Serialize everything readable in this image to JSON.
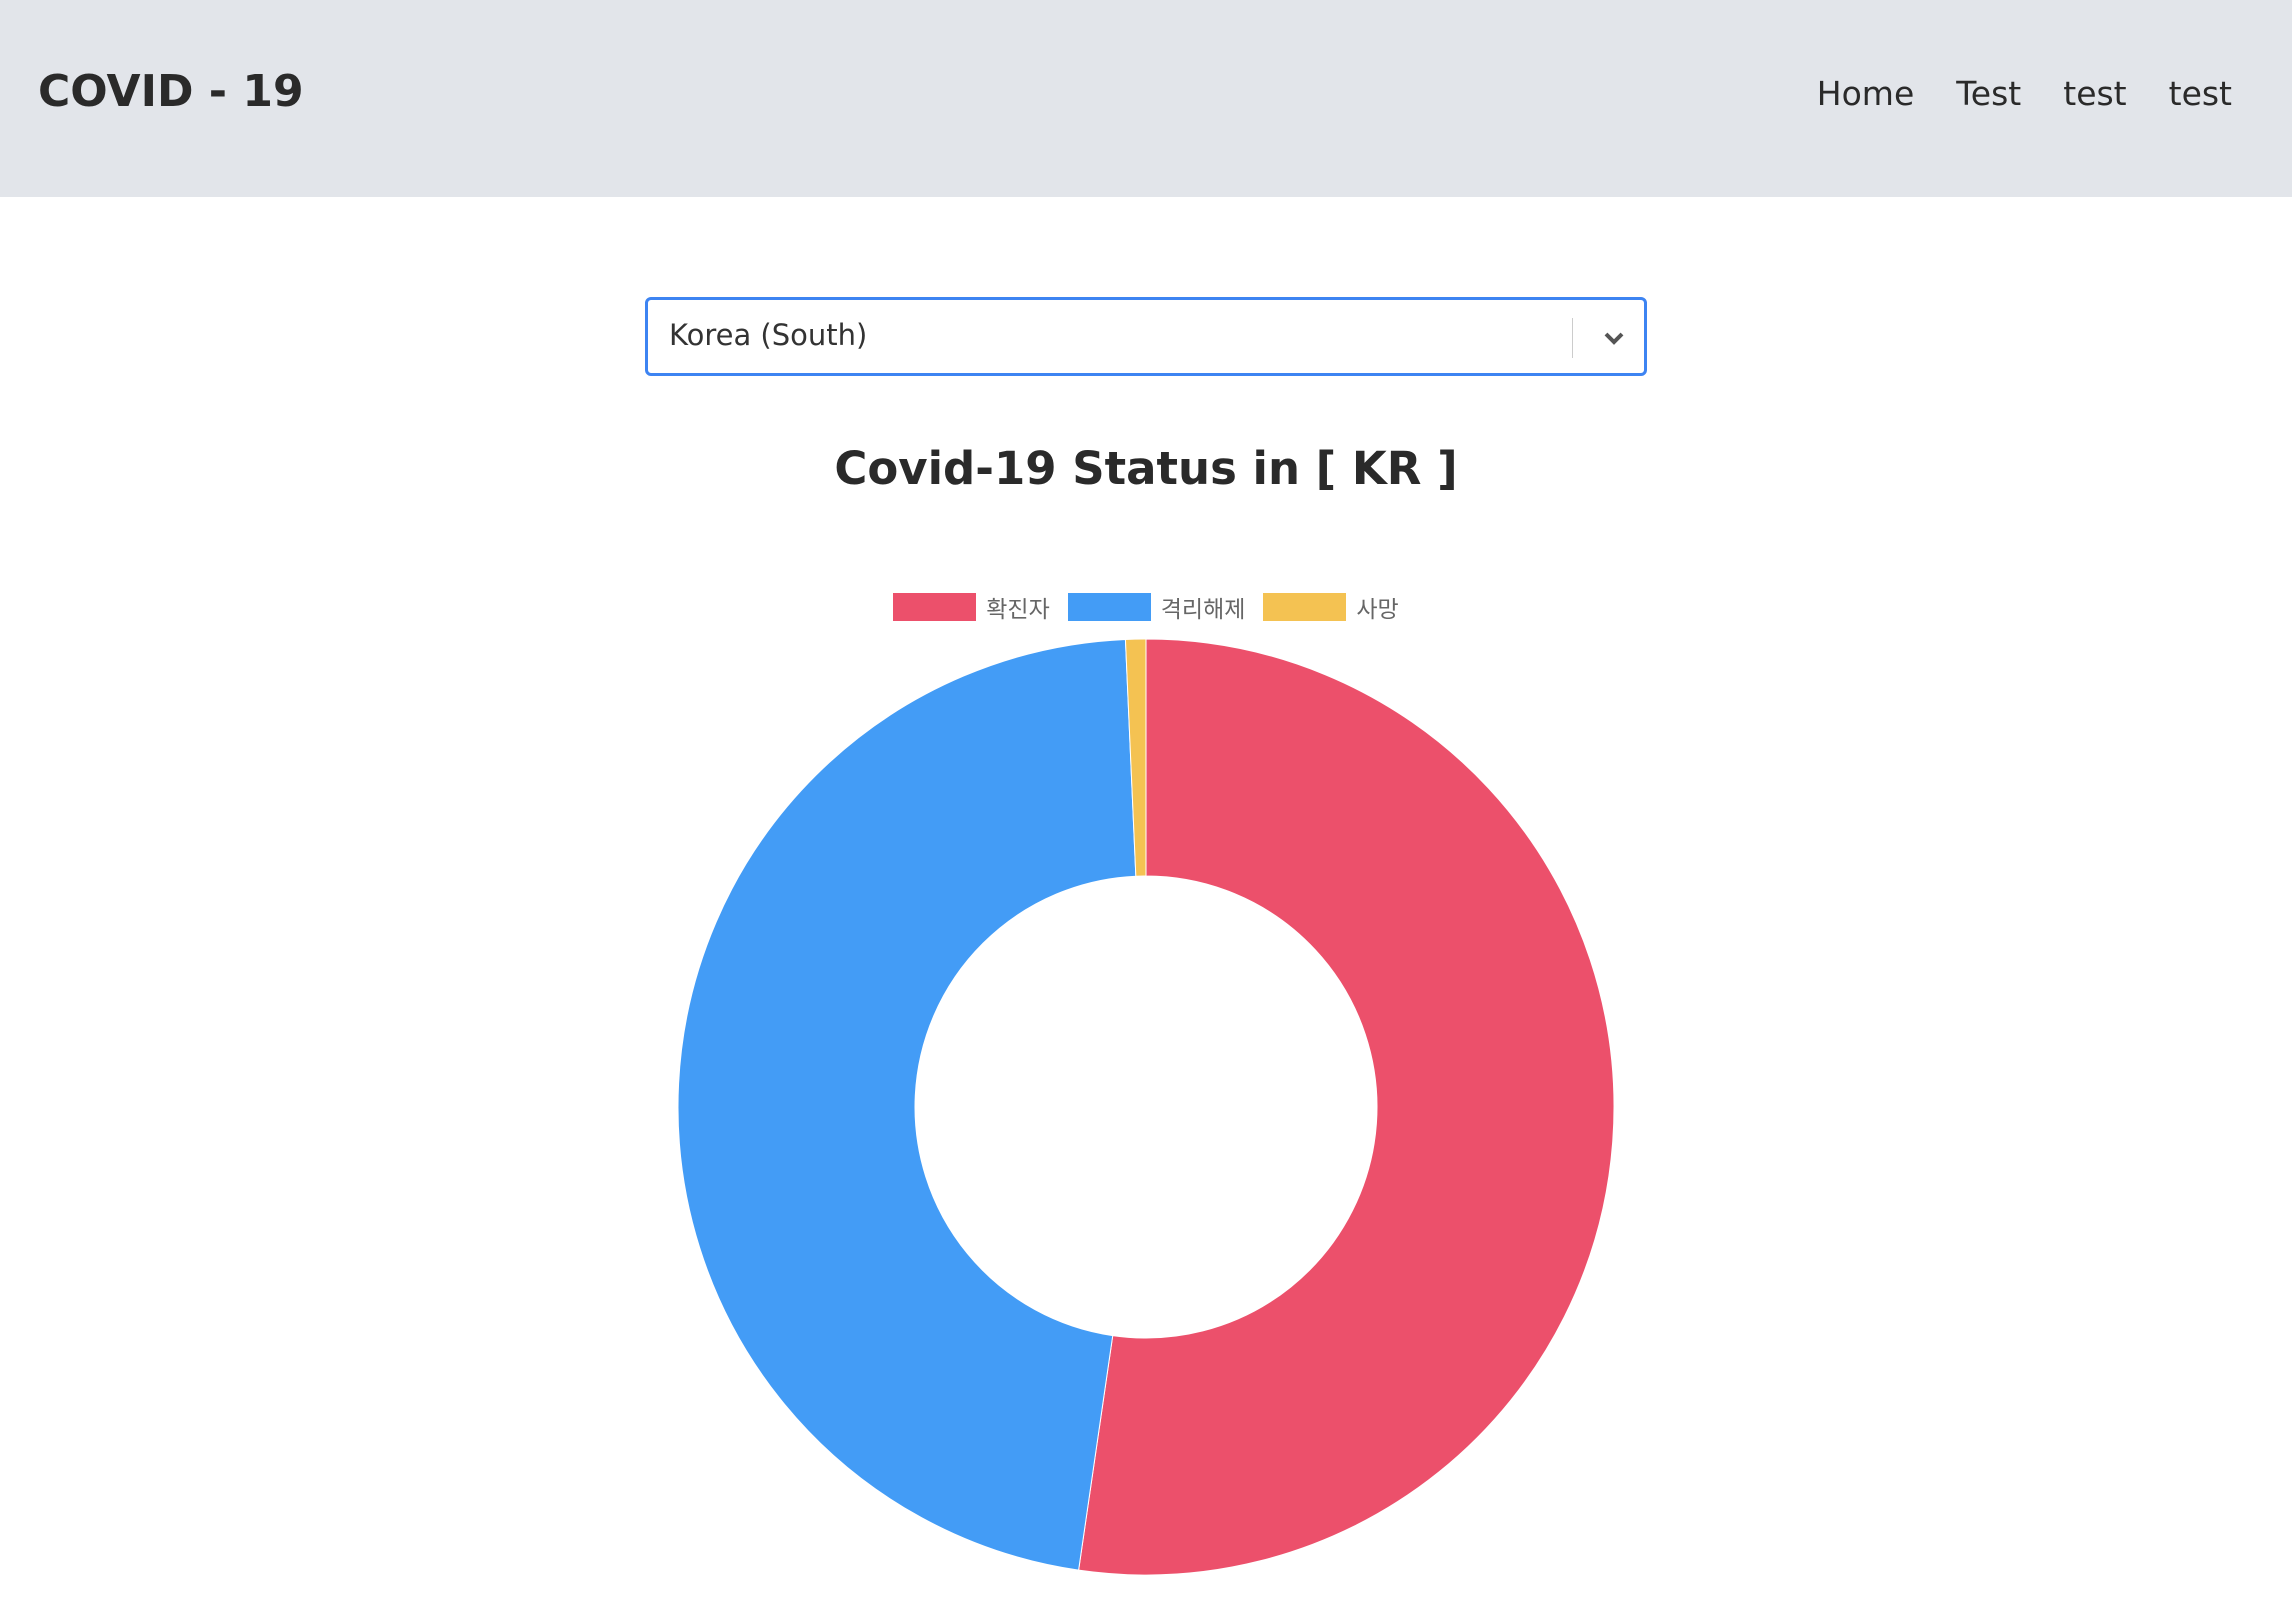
{
  "header": {
    "brand": "COVID - 19",
    "nav": [
      "Home",
      "Test",
      "test",
      "test"
    ]
  },
  "select": {
    "value": "Korea (South)"
  },
  "chart_data": {
    "type": "doughnut",
    "title": "Covid-19 Status in [ KR ]",
    "legend_position": "top",
    "categories": [
      "확진자",
      "격리해제",
      "사망"
    ],
    "values": [
      52.3,
      47.0,
      0.7
    ],
    "colors": [
      "#ec506b",
      "#439cf6",
      "#f4c252"
    ]
  }
}
